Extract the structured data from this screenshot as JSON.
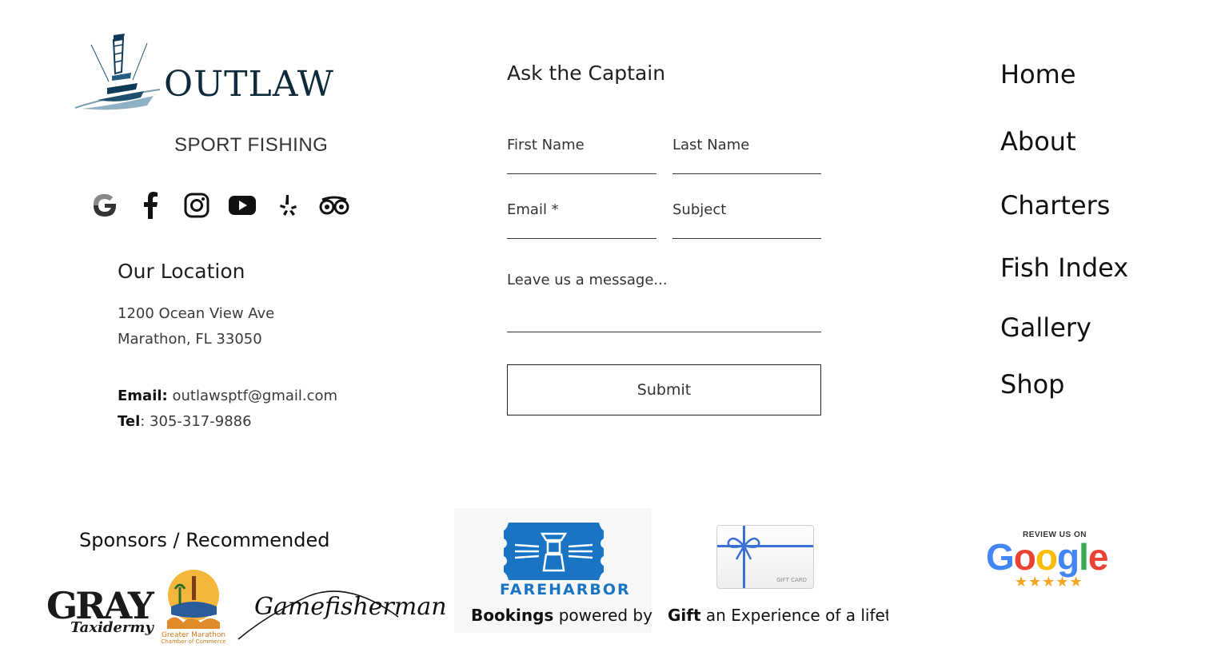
{
  "brand": {
    "name": "OUTLAW",
    "tagline": "SPORT FISHING"
  },
  "social": [
    {
      "name": "google-icon"
    },
    {
      "name": "facebook-icon"
    },
    {
      "name": "instagram-icon"
    },
    {
      "name": "youtube-icon"
    },
    {
      "name": "yelp-icon"
    },
    {
      "name": "tripadvisor-icon"
    }
  ],
  "location": {
    "title": "Our Location",
    "address_line1": "1200 Ocean View Ave",
    "address_line2": "Marathon, FL 33050",
    "email_label": "Email:",
    "email_value": " outlawsptf@gmail.com",
    "tel_label": "Tel",
    "tel_value": ": 305-317-9886"
  },
  "contact_form": {
    "title": "Ask the Captain",
    "first_name": "First Name",
    "last_name": "Last Name",
    "email": "Email *",
    "subject": "Subject",
    "message": "Leave us a message...",
    "submit": "Submit"
  },
  "nav": {
    "home": "Home",
    "about": "About",
    "charters": "Charters",
    "fish_index": "Fish Index",
    "gallery": "Gallery",
    "shop": "Shop"
  },
  "sponsors": {
    "title": "Sponsors / Recommended",
    "gray": "GRAY",
    "taxidermy": "Taxidermy",
    "gamefisherman": "Gamefisherman"
  },
  "fareharbor": {
    "logo_text": "FAREHARBOR",
    "caption_bold": "Bookings",
    "caption_rest": " powered by"
  },
  "gift": {
    "card_text": "GIFT CARD",
    "caption_bold": "Gift",
    "caption_rest": " an Experience of a lifetim"
  },
  "google_review": {
    "top": "REVIEW US ON",
    "word": [
      "G",
      "o",
      "o",
      "g",
      "l",
      "e"
    ],
    "stars": "★★★★★"
  },
  "colors": {
    "logo_navy": "#0f2a3a",
    "fareharbor_blue": "#1a74c4",
    "star_gold": "#f5a623"
  }
}
